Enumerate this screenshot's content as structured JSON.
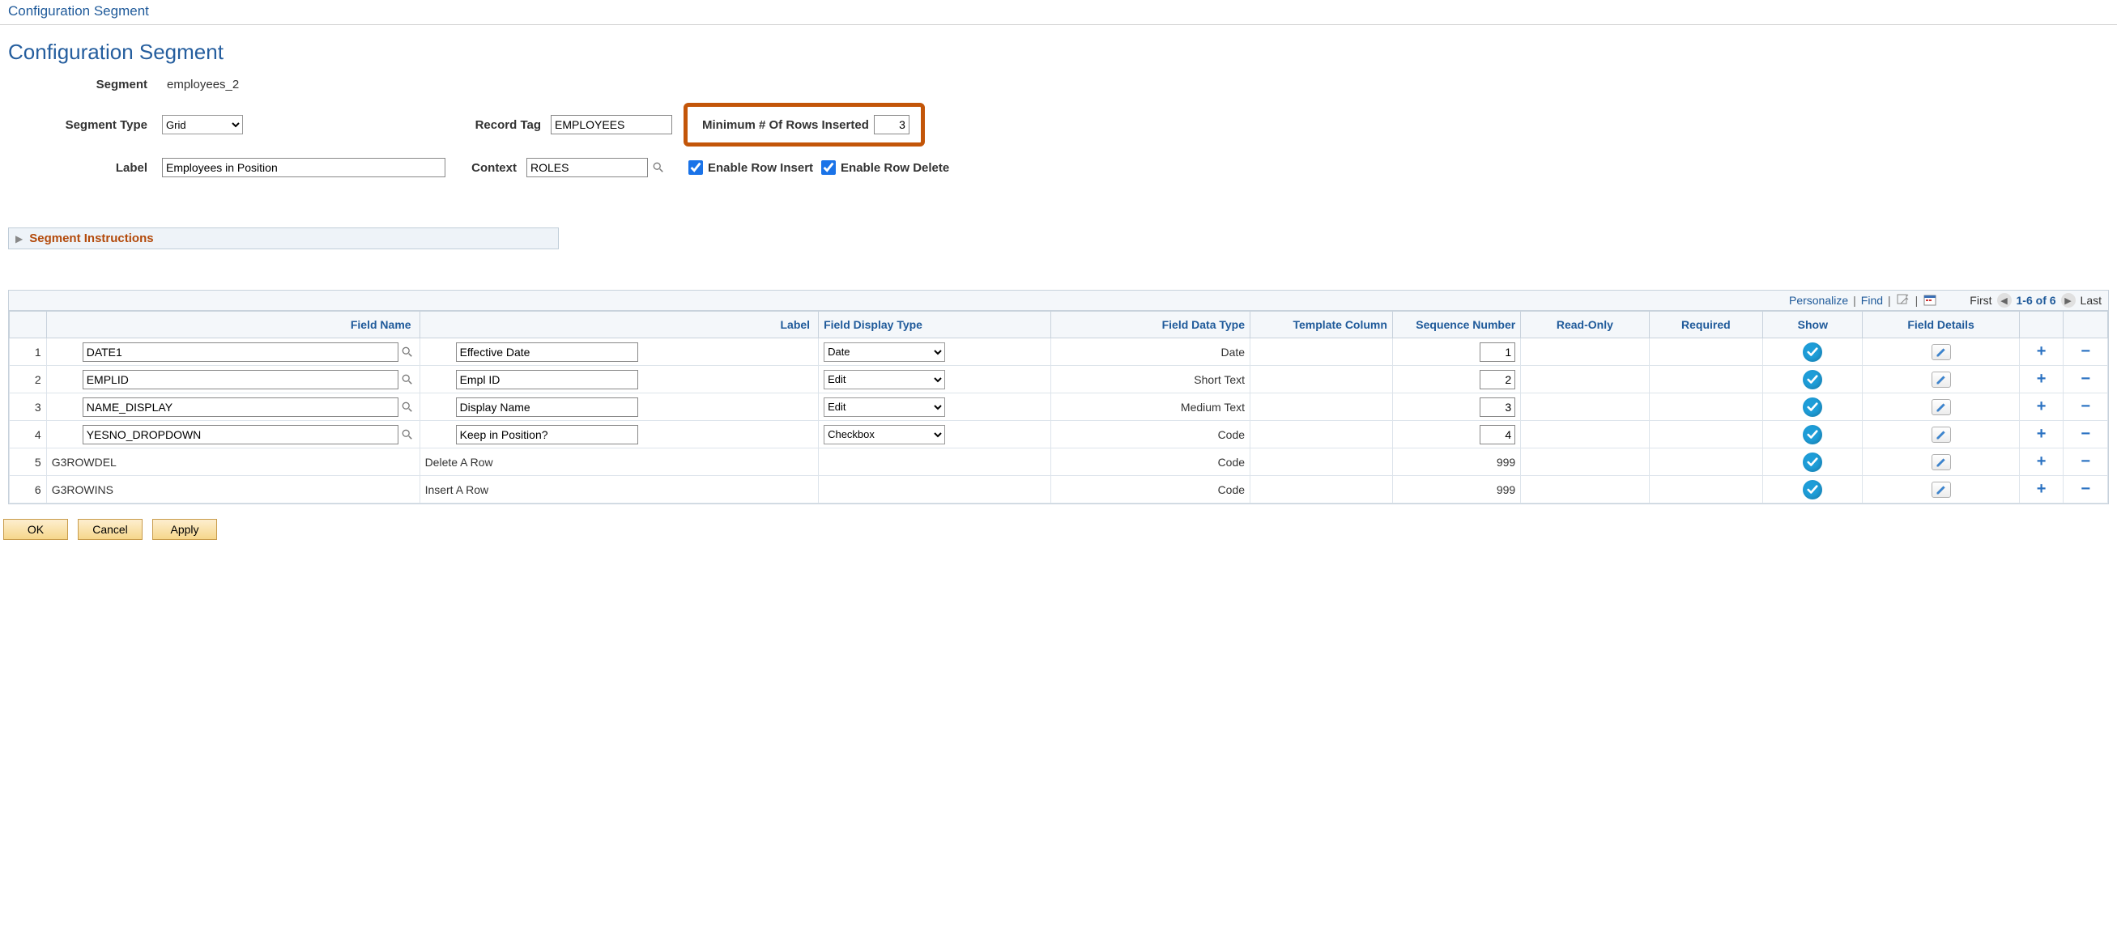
{
  "top_link": "Configuration Segment",
  "page_title": "Configuration Segment",
  "form": {
    "segment_label": "Segment",
    "segment_value": "employees_2",
    "segment_type_label": "Segment Type",
    "segment_type_value": "Grid",
    "segment_type_options": [
      "Grid"
    ],
    "record_tag_label": "Record Tag",
    "record_tag_value": "EMPLOYEES",
    "min_rows_label": "Minimum # Of Rows Inserted",
    "min_rows_value": "3",
    "label_label": "Label",
    "label_value": "Employees in Position",
    "context_label": "Context",
    "context_value": "ROLES",
    "enable_insert_label": "Enable Row Insert",
    "enable_insert_checked": true,
    "enable_delete_label": "Enable Row Delete",
    "enable_delete_checked": true
  },
  "collapse": {
    "title": "Segment Instructions"
  },
  "grid": {
    "toolbar": {
      "personalize": "Personalize",
      "find": "Find",
      "first": "First",
      "range": "1-6 of 6",
      "last": "Last"
    },
    "headers": {
      "field_name": "Field Name",
      "label": "Label",
      "field_display_type": "Field Display Type",
      "field_data_type": "Field Data Type",
      "template_column": "Template Column",
      "sequence_number": "Sequence Number",
      "read_only": "Read-Only",
      "required": "Required",
      "show": "Show",
      "field_details": "Field Details"
    },
    "rows": [
      {
        "num": "1",
        "field_name": "DATE1",
        "label": "Effective Date",
        "display_type": "Date",
        "data_type": "Date",
        "seq": "1",
        "editable": true
      },
      {
        "num": "2",
        "field_name": "EMPLID",
        "label": "Empl ID",
        "display_type": "Edit",
        "data_type": "Short Text",
        "seq": "2",
        "editable": true
      },
      {
        "num": "3",
        "field_name": "NAME_DISPLAY",
        "label": "Display Name",
        "display_type": "Edit",
        "data_type": "Medium Text",
        "seq": "3",
        "editable": true
      },
      {
        "num": "4",
        "field_name": "YESNO_DROPDOWN",
        "label": "Keep in Position?",
        "display_type": "Checkbox",
        "data_type": "Code",
        "seq": "4",
        "editable": true
      },
      {
        "num": "5",
        "field_name": "G3ROWDEL",
        "label": "Delete A Row",
        "display_type": "",
        "data_type": "Code",
        "seq": "999",
        "editable": false
      },
      {
        "num": "6",
        "field_name": "G3ROWINS",
        "label": "Insert A Row",
        "display_type": "",
        "data_type": "Code",
        "seq": "999",
        "editable": false
      }
    ]
  },
  "buttons": {
    "ok": "OK",
    "cancel": "Cancel",
    "apply": "Apply"
  }
}
